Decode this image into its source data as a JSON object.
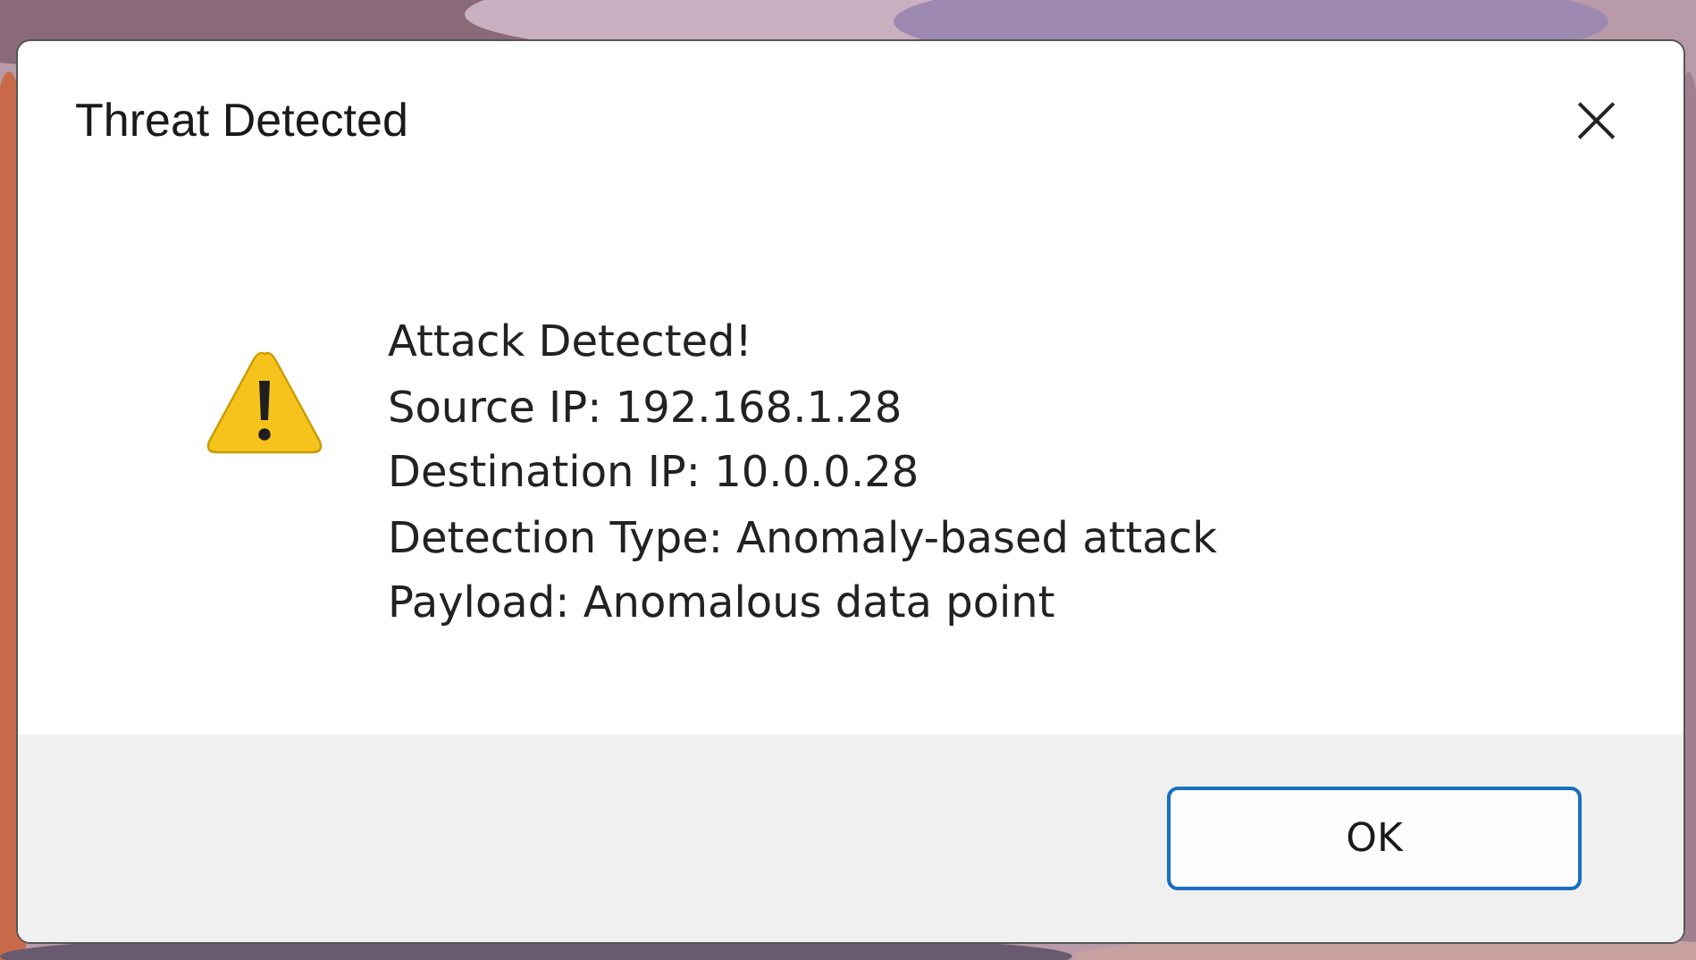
{
  "window": {
    "title": "Threat Detected",
    "close": "×"
  },
  "message": {
    "lines": [
      "Attack Detected!",
      "Source IP: 192.168.1.28",
      "Destination IP: 10.0.0.28",
      "Detection Type: Anomaly-based attack",
      "Payload: Anomalous data point"
    ]
  },
  "buttons": [
    {
      "label": "OK",
      "selected": true
    }
  ]
}
